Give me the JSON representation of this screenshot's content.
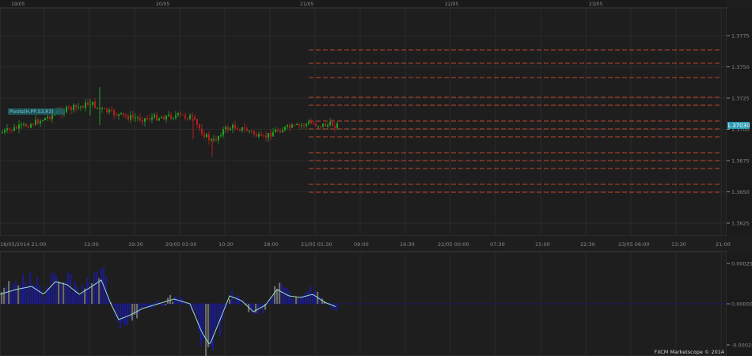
{
  "top_dates": [
    "19/05",
    "20/05",
    "21/05",
    "22/05",
    "23/05"
  ],
  "time_labels": [
    "18/05/2014 21:00",
    "12:00",
    "19:30",
    "20/05 03:00",
    "10:30",
    "18:00",
    "21/05 01:30",
    "09:00",
    "16:30",
    "22/05 00:00",
    "07:30",
    "15:00",
    "22:30",
    "23/05 06:00",
    "13:30",
    "21:00"
  ],
  "price_labels": [
    "1.3775",
    "1.3750",
    "1.3725",
    "1.3700",
    "1.3675",
    "1.3650",
    "1.3625"
  ],
  "current_price": "1.37030",
  "overlay_tag": "Pivots(H,PP,S3,R3)",
  "indicator_labels": [
    "0.00025",
    "0.00000",
    "-0.00025"
  ],
  "watermark": "FXCM Marketscope © 2014",
  "colors": {
    "background": "#1e1e1e",
    "grid": "#2b2b2b",
    "up_candle": "#1fa11f",
    "down_candle": "#b41e1e",
    "pivot_line": "#c0462a",
    "histogram_positive": "#1b1b8a",
    "histogram_negative": "#1b1b8a",
    "histogram_grey": "#6a6a6a",
    "signal_line": "#9ee0c8",
    "price_tag": "#2a9bb3",
    "date_marker": "#c9a13a"
  }
}
